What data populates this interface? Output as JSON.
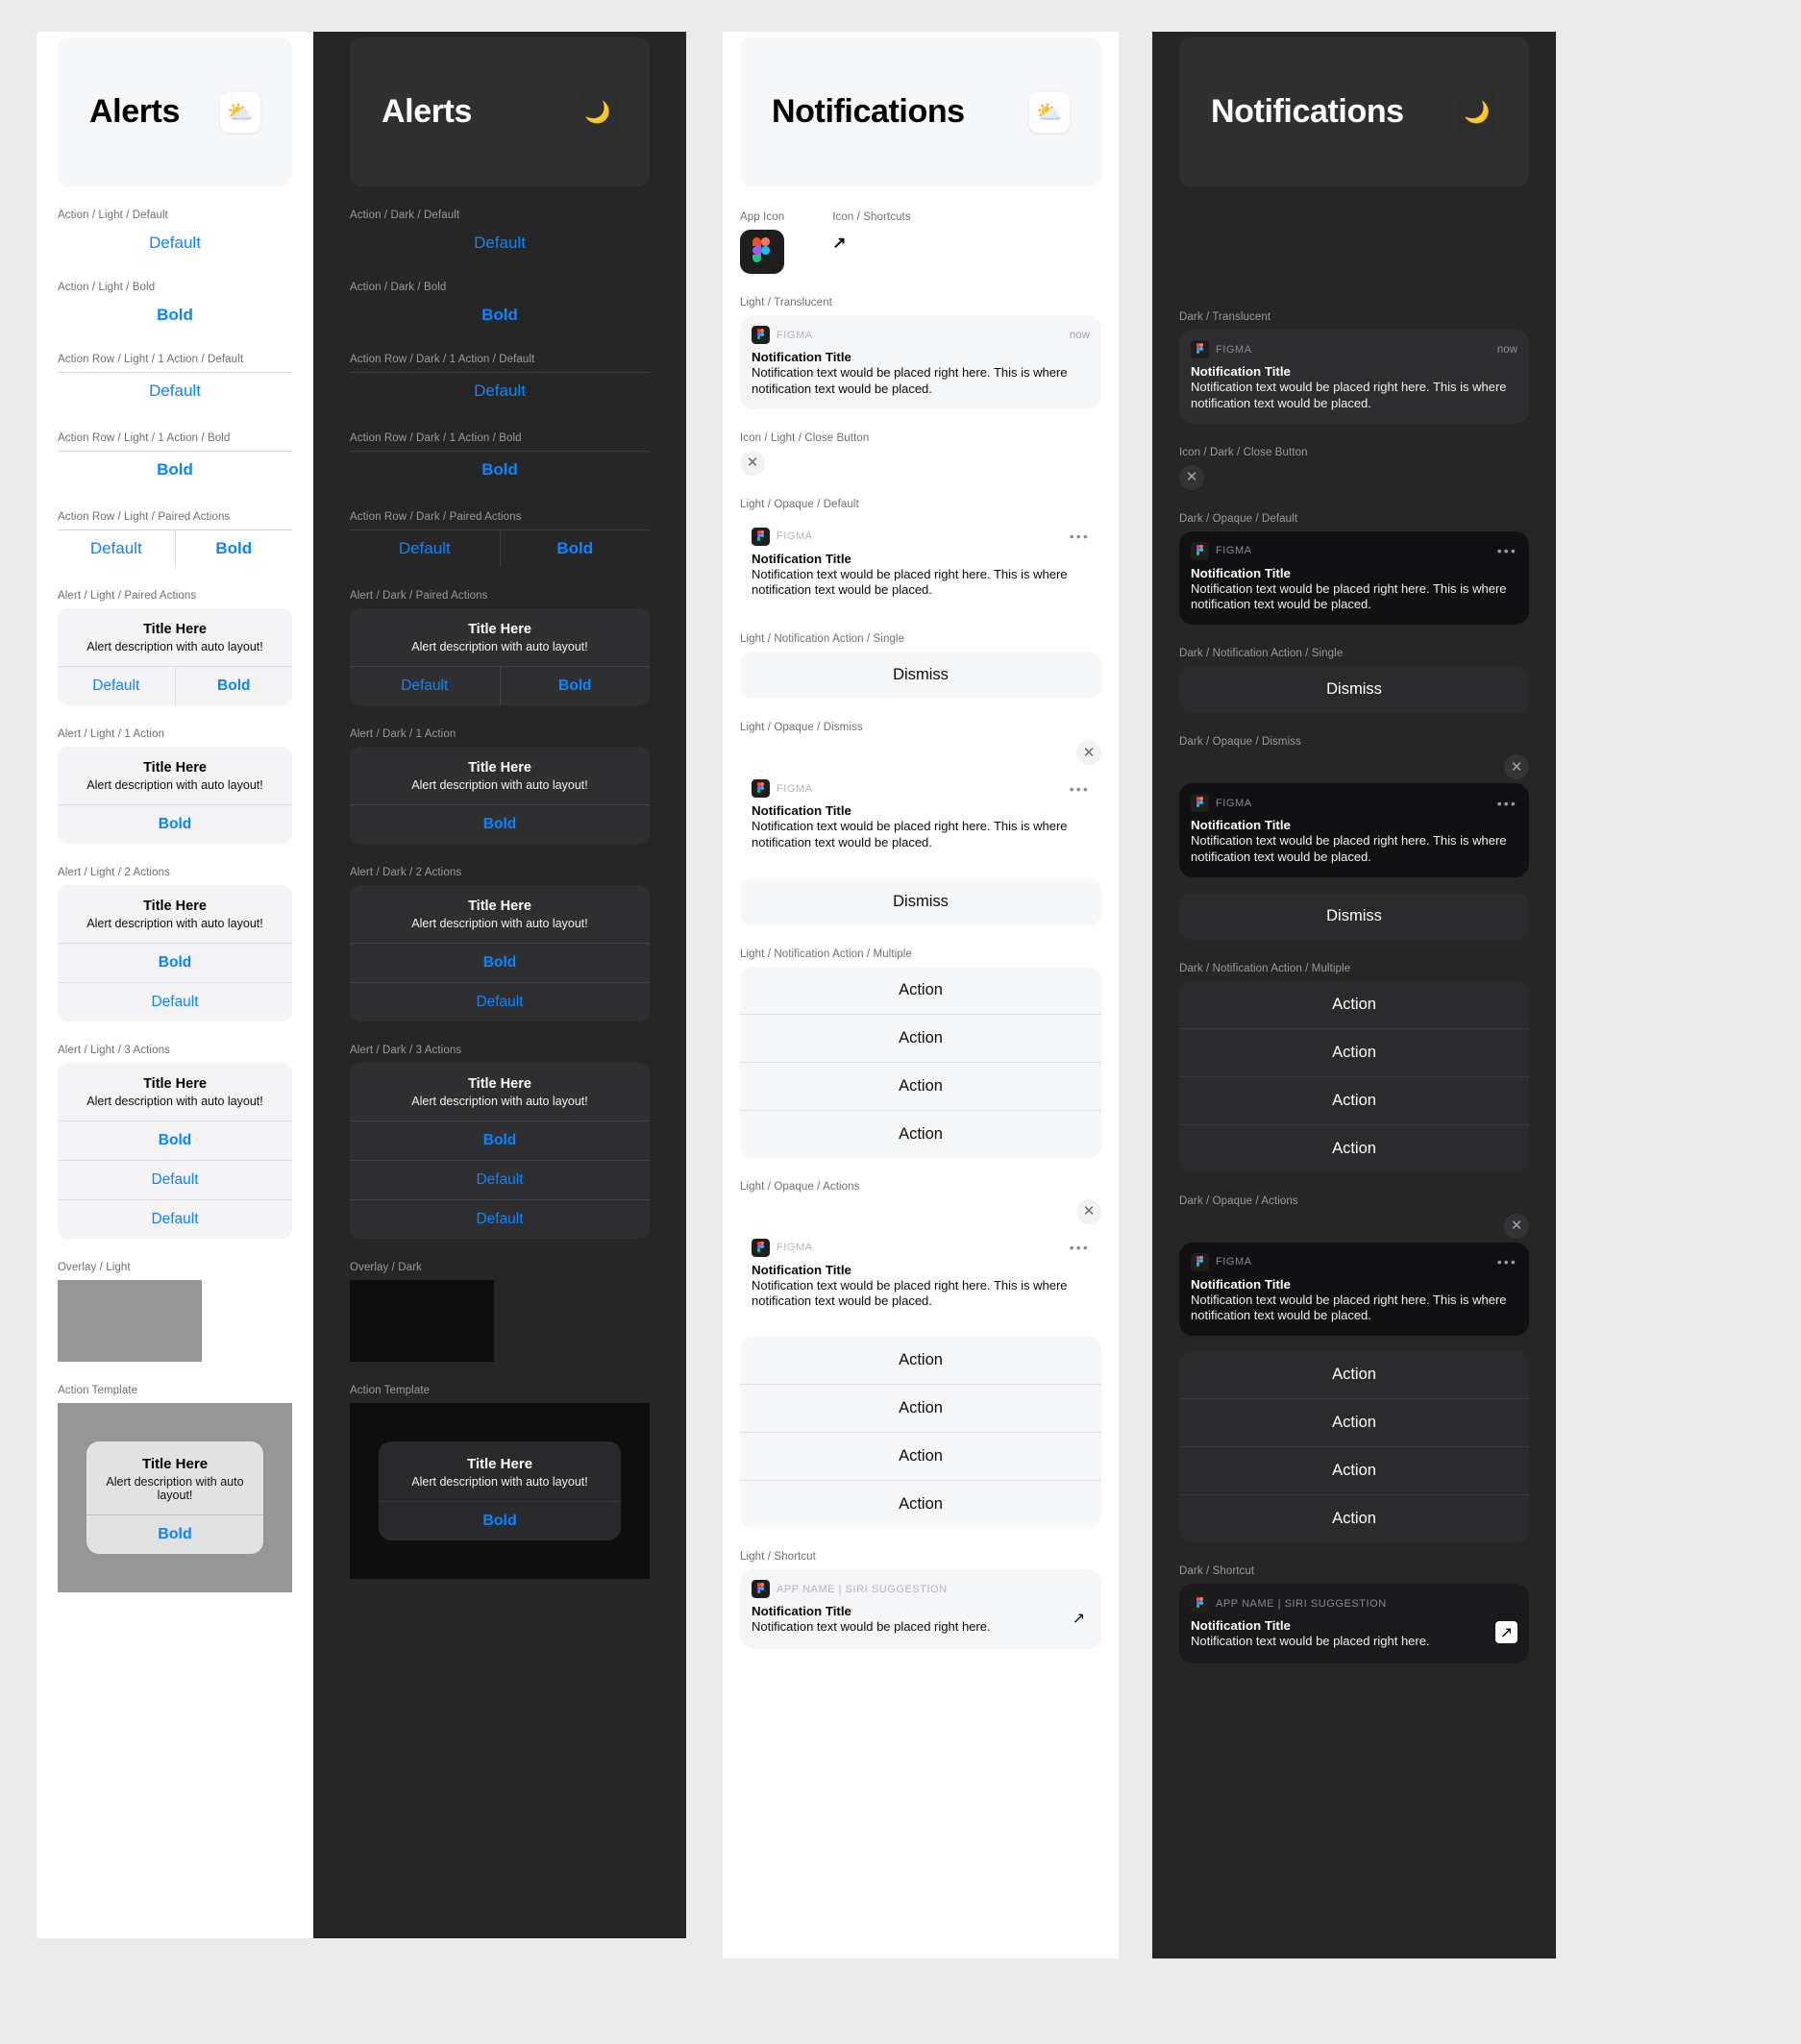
{
  "columns": {
    "alerts_light": {
      "title": "Alerts",
      "mode_icon": "sun-behind-cloud-icon",
      "mode_glyph": "⛅",
      "sections": [
        {
          "label": "Action / Light / Default",
          "kind": "action-text",
          "text": "Default",
          "weight": "default"
        },
        {
          "label": "Action / Light / Bold",
          "kind": "action-text",
          "text": "Bold",
          "weight": "bold"
        },
        {
          "label": "Action Row / Light / 1 Action / Default",
          "kind": "action-row",
          "items": [
            {
              "text": "Default",
              "weight": "default"
            }
          ]
        },
        {
          "label": "Action Row / Light / 1 Action / Bold",
          "kind": "action-row",
          "items": [
            {
              "text": "Bold",
              "weight": "bold"
            }
          ]
        },
        {
          "label": "Action Row / Light / Paired Actions",
          "kind": "action-row",
          "items": [
            {
              "text": "Default",
              "weight": "default"
            },
            {
              "text": "Bold",
              "weight": "bold"
            }
          ]
        },
        {
          "label": "Alert / Light / Paired Actions",
          "kind": "alert",
          "title": "Title Here",
          "desc": "Alert description with auto layout!",
          "orientation": "row",
          "actions": [
            {
              "text": "Default",
              "weight": "default"
            },
            {
              "text": "Bold",
              "weight": "bold"
            }
          ]
        },
        {
          "label": "Alert / Light / 1 Action",
          "kind": "alert",
          "title": "Title Here",
          "desc": "Alert description with auto layout!",
          "orientation": "col",
          "actions": [
            {
              "text": "Bold",
              "weight": "bold"
            }
          ]
        },
        {
          "label": "Alert / Light / 2 Actions",
          "kind": "alert",
          "title": "Title Here",
          "desc": "Alert description with auto layout!",
          "orientation": "col",
          "actions": [
            {
              "text": "Bold",
              "weight": "bold"
            },
            {
              "text": "Default",
              "weight": "default"
            }
          ]
        },
        {
          "label": "Alert / Light / 3 Actions",
          "kind": "alert",
          "title": "Title Here",
          "desc": "Alert description with auto layout!",
          "orientation": "col",
          "actions": [
            {
              "text": "Bold",
              "weight": "bold"
            },
            {
              "text": "Default",
              "weight": "default"
            },
            {
              "text": "Default",
              "weight": "default"
            }
          ]
        },
        {
          "label": "Overlay / Light",
          "kind": "overlay",
          "color": "#969696"
        },
        {
          "label": "Action Template",
          "kind": "template",
          "bg": "#969696",
          "title": "Title Here",
          "desc": "Alert description with auto layout!",
          "action": "Bold"
        }
      ]
    },
    "alerts_dark": {
      "title": "Alerts",
      "mode_icon": "crescent-moon-icon",
      "mode_glyph": "🌙",
      "sections": [
        {
          "label": "Action / Dark / Default",
          "kind": "action-text",
          "text": "Default",
          "weight": "default"
        },
        {
          "label": "Action / Dark / Bold",
          "kind": "action-text",
          "text": "Bold",
          "weight": "bold"
        },
        {
          "label": "Action Row / Dark / 1 Action / Default",
          "kind": "action-row",
          "items": [
            {
              "text": "Default",
              "weight": "default"
            }
          ]
        },
        {
          "label": "Action Row / Dark / 1 Action / Bold",
          "kind": "action-row",
          "items": [
            {
              "text": "Bold",
              "weight": "bold"
            }
          ]
        },
        {
          "label": "Action Row / Dark / Paired Actions",
          "kind": "action-row",
          "items": [
            {
              "text": "Default",
              "weight": "default"
            },
            {
              "text": "Bold",
              "weight": "bold"
            }
          ]
        },
        {
          "label": "Alert / Dark / Paired Actions",
          "kind": "alert",
          "title": "Title Here",
          "desc": "Alert description with auto layout!",
          "orientation": "row",
          "actions": [
            {
              "text": "Default",
              "weight": "default"
            },
            {
              "text": "Bold",
              "weight": "bold"
            }
          ]
        },
        {
          "label": "Alert / Dark / 1 Action",
          "kind": "alert",
          "title": "Title Here",
          "desc": "Alert description with auto layout!",
          "orientation": "col",
          "actions": [
            {
              "text": "Bold",
              "weight": "bold"
            }
          ]
        },
        {
          "label": "Alert / Dark / 2 Actions",
          "kind": "alert",
          "title": "Title Here",
          "desc": "Alert description with auto layout!",
          "orientation": "col",
          "actions": [
            {
              "text": "Bold",
              "weight": "bold"
            },
            {
              "text": "Default",
              "weight": "default"
            }
          ]
        },
        {
          "label": "Alert / Dark / 3 Actions",
          "kind": "alert",
          "title": "Title Here",
          "desc": "Alert description with auto layout!",
          "orientation": "col",
          "actions": [
            {
              "text": "Bold",
              "weight": "bold"
            },
            {
              "text": "Default",
              "weight": "default"
            },
            {
              "text": "Default",
              "weight": "default"
            }
          ]
        },
        {
          "label": "Overlay / Dark",
          "kind": "overlay",
          "color": "#0e0e0e"
        },
        {
          "label": "Action Template",
          "kind": "template",
          "bg": "#0e0e0e",
          "title": "Title Here",
          "desc": "Alert description with auto layout!",
          "action": "Bold"
        }
      ]
    },
    "notif_light": {
      "title": "Notifications",
      "mode_icon": "sun-behind-cloud-icon",
      "mode_glyph": "⛅",
      "app_icon_label": "App Icon",
      "shortcut_icon_label": "Icon / Shortcuts",
      "shortcut_icon_glyph": "↗",
      "sections": [
        {
          "label": "Light / Translucent",
          "kind": "note",
          "style": "translucent",
          "app": "FIGMA",
          "meta_kind": "time",
          "time": "now",
          "title": "Notification Title",
          "body": "Notification text would be placed right here. This is where notification text would be placed."
        },
        {
          "label": "Icon / Light / Close Button",
          "kind": "close-icon"
        },
        {
          "label": "Light / Opaque / Default",
          "kind": "note",
          "style": "opaque",
          "app": "FIGMA",
          "meta_kind": "dots",
          "dots": "•••",
          "title": "Notification Title",
          "body": "Notification text would be placed right here. This is where notification text would be placed."
        },
        {
          "label": "Light / Notification Action / Single",
          "kind": "act-list",
          "items": [
            "Dismiss"
          ]
        },
        {
          "label": "Light / Opaque / Dismiss",
          "kind": "note-dismiss",
          "app": "FIGMA",
          "dots": "•••",
          "title": "Notification Title",
          "body": "Notification text would be placed right here. This is where notification text would be placed.",
          "items": [
            "Dismiss"
          ]
        },
        {
          "label": "Light / Notification Action / Multiple",
          "kind": "act-list",
          "items": [
            "Action",
            "Action",
            "Action",
            "Action"
          ]
        },
        {
          "label": "Light / Opaque / Actions",
          "kind": "note-dismiss",
          "app": "FIGMA",
          "dots": "•••",
          "title": "Notification Title",
          "body": "Notification text would be placed right here. This is where notification text would be placed.",
          "items": [
            "Action",
            "Action",
            "Action",
            "Action"
          ]
        },
        {
          "label": "Light / Shortcut",
          "kind": "shortcut",
          "app": "APP NAME | SIRI SUGGESTION",
          "title": "Notification Title",
          "body": "Notification text would be placed right here.",
          "arrow": "↗"
        }
      ]
    },
    "notif_dark": {
      "title": "Notifications",
      "mode_icon": "crescent-moon-icon",
      "mode_glyph": "🌙",
      "sections": [
        {
          "label": "Dark / Translucent",
          "kind": "note",
          "style": "translucent",
          "app": "FIGMA",
          "meta_kind": "time",
          "time": "now",
          "title": "Notification Title",
          "body": "Notification text would be placed right here. This is where notification text would be placed."
        },
        {
          "label": "Icon / Dark / Close Button",
          "kind": "close-icon"
        },
        {
          "label": "Dark / Opaque / Default",
          "kind": "note",
          "style": "opaque",
          "app": "FIGMA",
          "meta_kind": "dots",
          "dots": "•••",
          "title": "Notification Title",
          "body": "Notification text would be placed right here. This is where notification text would be placed."
        },
        {
          "label": "Dark / Notification Action / Single",
          "kind": "act-list",
          "items": [
            "Dismiss"
          ]
        },
        {
          "label": "Dark / Opaque / Dismiss",
          "kind": "note-dismiss",
          "app": "FIGMA",
          "dots": "•••",
          "title": "Notification Title",
          "body": "Notification text would be placed right here. This is where notification text would be placed.",
          "items": [
            "Dismiss"
          ]
        },
        {
          "label": "Dark / Notification Action / Multiple",
          "kind": "act-list",
          "items": [
            "Action",
            "Action",
            "Action",
            "Action"
          ]
        },
        {
          "label": "Dark / Opaque / Actions",
          "kind": "note-dismiss",
          "app": "FIGMA",
          "dots": "•••",
          "title": "Notification Title",
          "body": "Notification text would be placed right here. This is where notification text would be placed.",
          "items": [
            "Action",
            "Action",
            "Action",
            "Action"
          ]
        },
        {
          "label": "Dark / Shortcut",
          "kind": "shortcut",
          "app": "APP NAME | SIRI SUGGESTION",
          "title": "Notification Title",
          "body": "Notification text would be placed right here.",
          "arrow": "↗"
        }
      ]
    }
  },
  "colors": {
    "accent_blue": "#0a84ff",
    "light_bg": "#ffffff",
    "dark_bg": "#262626",
    "page_bg": "#ebebeb",
    "overlay_light": "#969696",
    "overlay_dark": "#0e0e0e"
  },
  "close_glyph": "✕"
}
